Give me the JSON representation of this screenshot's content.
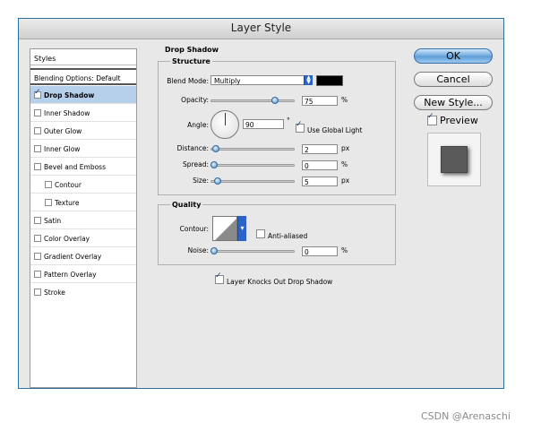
{
  "window": {
    "title": "Layer Style"
  },
  "styles_panel": {
    "header": "Styles",
    "blending_options": "Blending Options: Default",
    "items": [
      {
        "label": "Drop Shadow",
        "checked": true,
        "selected": true
      },
      {
        "label": "Inner Shadow",
        "checked": false
      },
      {
        "label": "Outer Glow",
        "checked": false
      },
      {
        "label": "Inner Glow",
        "checked": false
      },
      {
        "label": "Bevel and Emboss",
        "checked": false
      },
      {
        "label": "Contour",
        "checked": false
      },
      {
        "label": "Texture",
        "checked": false
      },
      {
        "label": "Satin",
        "checked": false
      },
      {
        "label": "Color Overlay",
        "checked": false
      },
      {
        "label": "Gradient Overlay",
        "checked": false
      },
      {
        "label": "Pattern Overlay",
        "checked": false
      },
      {
        "label": "Stroke",
        "checked": false
      }
    ]
  },
  "drop_shadow": {
    "group_title": "Drop Shadow",
    "structure": {
      "title": "Structure",
      "blend_mode_label": "Blend Mode:",
      "blend_mode_value": "Multiply",
      "shadow_color": "#000000",
      "opacity_label": "Opacity:",
      "opacity_value": "75",
      "opacity_unit": "%",
      "angle_label": "Angle:",
      "angle_value": "90",
      "angle_unit": "°",
      "use_global_light_label": "Use Global Light",
      "use_global_light": true,
      "distance_label": "Distance:",
      "distance_value": "2",
      "distance_unit": "px",
      "spread_label": "Spread:",
      "spread_value": "0",
      "spread_unit": "%",
      "size_label": "Size:",
      "size_value": "5",
      "size_unit": "px"
    },
    "quality": {
      "title": "Quality",
      "contour_label": "Contour:",
      "anti_aliased_label": "Anti-aliased",
      "anti_aliased": false,
      "noise_label": "Noise:",
      "noise_value": "0",
      "noise_unit": "%"
    },
    "knockout_label": "Layer Knocks Out Drop Shadow",
    "knockout": true
  },
  "buttons": {
    "ok": "OK",
    "cancel": "Cancel",
    "new_style": "New Style..."
  },
  "preview": {
    "label": "Preview",
    "checked": true
  },
  "watermark": "CSDN @Arenaschi",
  "colors": {
    "accent": "#5a9ad5",
    "selection": "#b6d0ec",
    "window_border": "#2f6f9a"
  }
}
